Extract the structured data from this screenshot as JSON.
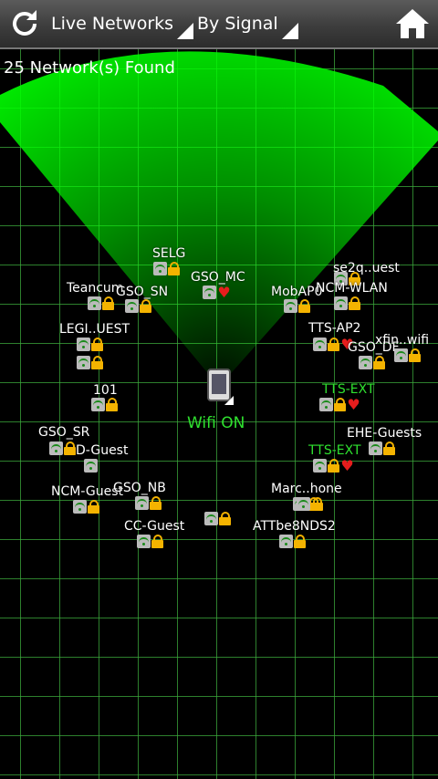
{
  "toolbar": {
    "refresh_icon": "refresh-icon",
    "view_mode": "Live Networks",
    "sort_mode": "By Signal",
    "home_icon": "home-icon"
  },
  "status": {
    "count_text": "25 Network(s) Found"
  },
  "center": {
    "label": "Wifi ON",
    "device_icon": "phone-icon"
  },
  "colors": {
    "sweep": "#00ff00",
    "grid": "#3caa3c",
    "secure": "#f4b300",
    "favorite": "#e61d1d"
  },
  "networks": [
    {
      "name": "SELG",
      "lock": true,
      "heart": false
    },
    {
      "name": "GSO_MC",
      "lock": false,
      "heart": true
    },
    {
      "name": "Teancum",
      "lock": true,
      "heart": false
    },
    {
      "name": "GSO_SN",
      "lock": true,
      "heart": false
    },
    {
      "name": "se2q..uest",
      "lock": true,
      "heart": false
    },
    {
      "name": "MobAP0",
      "lock": true,
      "heart": false
    },
    {
      "name": "NCM-WLAN",
      "lock": true,
      "heart": false
    },
    {
      "name": "LEGI..UEST",
      "lock": true,
      "heart": false
    },
    {
      "name": "TTS-AP2",
      "lock": true,
      "heart": true
    },
    {
      "name": "GSO_DF",
      "lock": true,
      "heart": false
    },
    {
      "name": "xfin..wifi",
      "lock": false,
      "heart": false
    },
    {
      "name": "101",
      "lock": true,
      "heart": false
    },
    {
      "name": "TTS-EXT",
      "lock": true,
      "heart": true
    },
    {
      "name": "GSO_SR",
      "lock": true,
      "heart": false
    },
    {
      "name": "D-Guest",
      "lock": false,
      "heart": false
    },
    {
      "name": "EHE-Guests",
      "lock": true,
      "heart": false
    },
    {
      "name": "TTS-EXT",
      "lock": true,
      "heart": true
    },
    {
      "name": "NCM-Guest",
      "lock": true,
      "heart": false
    },
    {
      "name": "GSO_NB",
      "lock": true,
      "heart": false
    },
    {
      "name": "Marc..hone",
      "lock": true,
      "heart": false
    },
    {
      "name": "CC-Guest",
      "lock": true,
      "heart": false
    },
    {
      "name": "ATTbe8NDS2",
      "lock": true,
      "heart": false
    }
  ]
}
